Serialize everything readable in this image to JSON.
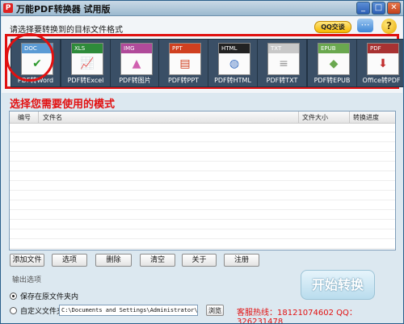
{
  "window": {
    "title": "万能PDF转换器  试用版",
    "app_icon": "pdf-app-icon",
    "controls": [
      "minimize",
      "maximize",
      "close"
    ],
    "control_glyphs": {
      "minimize": "_",
      "maximize": "□",
      "close": "✕"
    }
  },
  "header": {
    "subtitle": "请选择要转换到的目标文件格式",
    "qq_button": "QQ交谈",
    "menu_glyph": "⋯",
    "help_glyph": "?"
  },
  "formats": [
    {
      "label": "PDF转Word",
      "badge": "DOC",
      "badge_color": "#5b9bd5",
      "glyph": "✔",
      "glyph_color": "#2e9a2e",
      "selected": true
    },
    {
      "label": "PDF转Excel",
      "badge": "XLS",
      "badge_color": "#2e8b3a",
      "glyph": "📈",
      "glyph_color": "#d03030",
      "selected": false
    },
    {
      "label": "PDF转图片",
      "badge": "IMG",
      "badge_color": "#b04a9a",
      "glyph": "▲",
      "glyph_color": "#d060b0",
      "selected": false
    },
    {
      "label": "PDF转PPT",
      "badge": "PPT",
      "badge_color": "#d04020",
      "glyph": "▤",
      "glyph_color": "#d04020",
      "selected": false
    },
    {
      "label": "PDF转HTML",
      "badge": "HTML",
      "badge_color": "#222222",
      "glyph": "◍",
      "glyph_color": "#3a6fc0",
      "selected": false
    },
    {
      "label": "PDF转TXT",
      "badge": "TXT",
      "badge_color": "#c8c8c8",
      "glyph": "≡",
      "glyph_color": "#999999",
      "selected": false
    },
    {
      "label": "PDF转EPUB",
      "badge": "EPUB",
      "badge_color": "#6aa84f",
      "glyph": "◆",
      "glyph_color": "#6aa84f",
      "selected": false
    },
    {
      "label": "Office转PDF",
      "badge": "PDF",
      "badge_color": "#a83232",
      "glyph": "⬇",
      "glyph_color": "#c23030",
      "selected": false
    }
  ],
  "annotation_text": "选择您需要使用的模式",
  "table": {
    "columns": [
      "编号",
      "文件名",
      "文件大小",
      "转换进度"
    ],
    "rows": []
  },
  "buttons": [
    "添加文件",
    "选项",
    "删除",
    "清空",
    "关于",
    "注册"
  ],
  "output": {
    "section_label": "输出选项",
    "option_same_folder": "保存在原文件夹内",
    "option_custom_folder": "自定义文件夹",
    "selected": "same_folder",
    "path_value": "C:\\Documents and Settings\\Administrator\\桌面",
    "browse_label": "浏览"
  },
  "start_button": "开始转换",
  "hotline": "客服热线：18121074602 QQ：326231478"
}
